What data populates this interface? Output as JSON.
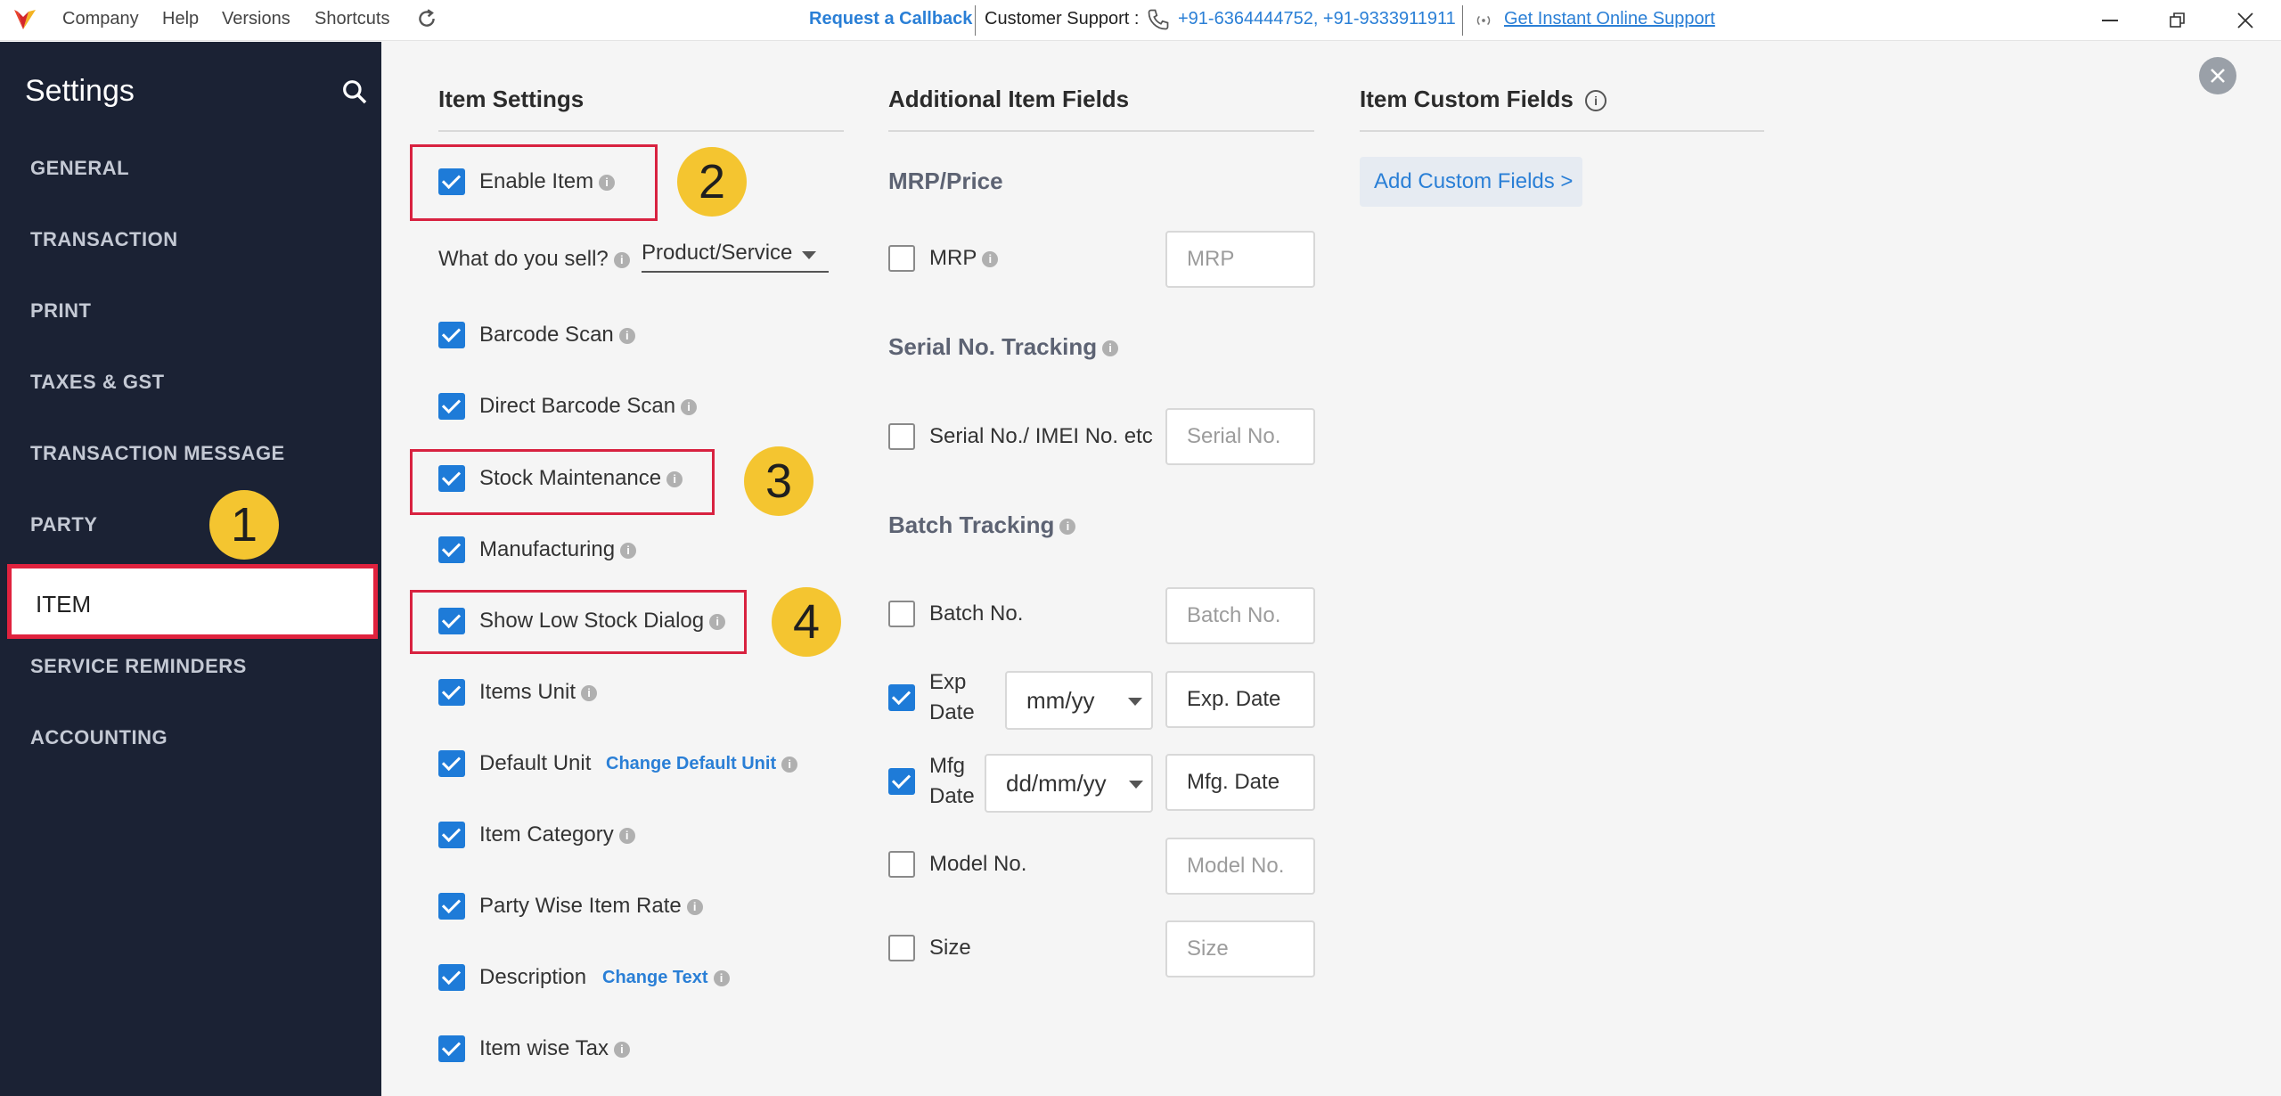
{
  "topbar": {
    "menu": [
      "Company",
      "Help",
      "Versions",
      "Shortcuts"
    ],
    "callback": "Request a Callback",
    "support_label": "Customer Support :",
    "phones": "+91-6364444752, +91-9333911911",
    "online_support": "Get Instant Online Support"
  },
  "sidebar": {
    "title": "Settings",
    "items": [
      "GENERAL",
      "TRANSACTION",
      "PRINT",
      "TAXES & GST",
      "TRANSACTION MESSAGE",
      "PARTY",
      "ITEM",
      "SERVICE REMINDERS",
      "ACCOUNTING"
    ],
    "active": "ITEM"
  },
  "badges": [
    "1",
    "2",
    "3",
    "4"
  ],
  "item_settings": {
    "header": "Item Settings",
    "enable_item": "Enable Item",
    "sell_label": "What do you sell?",
    "sell_value": "Product/Service",
    "options": [
      {
        "label": "Barcode Scan",
        "checked": true
      },
      {
        "label": "Direct Barcode Scan",
        "checked": true
      },
      {
        "label": "Stock Maintenance",
        "checked": true
      },
      {
        "label": "Manufacturing",
        "checked": true
      },
      {
        "label": "Show Low Stock Dialog",
        "checked": true
      },
      {
        "label": "Items Unit",
        "checked": true
      },
      {
        "label": "Default Unit",
        "checked": true
      },
      {
        "label": "Item Category",
        "checked": true
      },
      {
        "label": "Party Wise Item Rate",
        "checked": true
      },
      {
        "label": "Description",
        "checked": true
      },
      {
        "label": "Item wise Tax",
        "checked": true
      }
    ],
    "change_default_unit": "Change Default Unit",
    "change_text": "Change Text"
  },
  "additional": {
    "header": "Additional Item Fields",
    "mrp_head": "MRP/Price",
    "mrp_label": "MRP",
    "mrp_placeholder": "MRP",
    "serial_head": "Serial No. Tracking",
    "serial_label": "Serial No./ IMEI No. etc",
    "serial_placeholder": "Serial No.",
    "batch_head": "Batch Tracking",
    "batch_label": "Batch No.",
    "batch_placeholder": "Batch No.",
    "exp_label_1": "Exp",
    "exp_label_2": "Date",
    "exp_format": "mm/yy",
    "exp_field": "Exp. Date",
    "mfg_label_1": "Mfg",
    "mfg_label_2": "Date",
    "mfg_format": "dd/mm/yy",
    "mfg_field": "Mfg. Date",
    "model_label": "Model No.",
    "model_placeholder": "Model No.",
    "size_label": "Size",
    "size_placeholder": "Size"
  },
  "custom": {
    "header": "Item Custom Fields",
    "add_button": "Add Custom Fields >"
  },
  "colors": {
    "accent": "#1e7bd8",
    "sidebar": "#1b2234",
    "highlight": "#e0223e",
    "badge": "#f4c530"
  }
}
